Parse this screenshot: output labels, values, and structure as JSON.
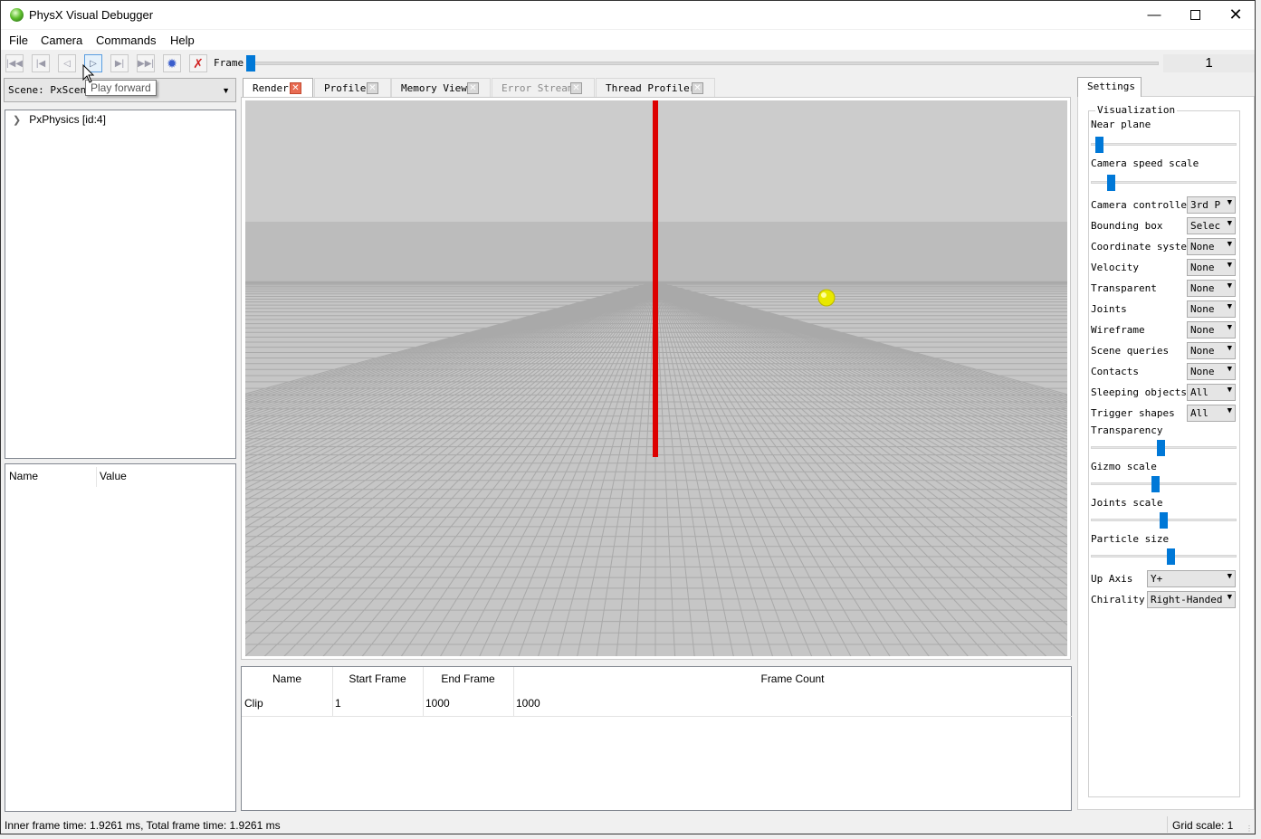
{
  "window": {
    "title": "PhysX Visual Debugger"
  },
  "menu": [
    "File",
    "Camera",
    "Commands",
    "Help"
  ],
  "toolbar": {
    "buttons": [
      "go-to-start",
      "step-back",
      "play-backward",
      "play-forward",
      "step-forward",
      "go-to-end",
      "record",
      "disconnect"
    ],
    "frame_label": "Frame",
    "frame_value": "1",
    "tooltip": "Play forward"
  },
  "scene": {
    "label": "Scene: PxScene"
  },
  "tree": {
    "items": [
      {
        "label": "PxPhysics [id:4]"
      }
    ]
  },
  "properties": {
    "headers": [
      "Name",
      "Value"
    ]
  },
  "tabs": [
    {
      "label": "Render",
      "active": true,
      "disabled": false
    },
    {
      "label": "Profile",
      "active": false,
      "disabled": false
    },
    {
      "label": "Memory View",
      "active": false,
      "disabled": false
    },
    {
      "label": "Error Stream",
      "active": false,
      "disabled": true
    },
    {
      "label": "Thread Profiler",
      "active": false,
      "disabled": false
    }
  ],
  "clips": {
    "headers": [
      "Name",
      "Start Frame",
      "End Frame",
      "Frame Count"
    ],
    "rows": [
      [
        "Clip",
        "1",
        "1000",
        "1000"
      ]
    ]
  },
  "settings": {
    "tab": "Settings",
    "group": "Visualization",
    "sliders": [
      {
        "label": "Near plane",
        "value": 0.03
      },
      {
        "label": "Camera speed scale",
        "value": 0.12
      },
      {
        "label": "Transparency",
        "value": 0.48
      },
      {
        "label": "Gizmo scale",
        "value": 0.44
      },
      {
        "label": "Joints scale",
        "value": 0.5
      },
      {
        "label": "Particle size",
        "value": 0.55
      }
    ],
    "selects": [
      {
        "label": "Camera controller",
        "value": "3rd P"
      },
      {
        "label": "Bounding box",
        "value": "Selec"
      },
      {
        "label": "Coordinate system",
        "value": "None"
      },
      {
        "label": "Velocity",
        "value": "None"
      },
      {
        "label": "Transparent",
        "value": "None"
      },
      {
        "label": "Joints",
        "value": "None"
      },
      {
        "label": "Wireframe",
        "value": "None"
      },
      {
        "label": "Scene queries",
        "value": "None"
      },
      {
        "label": "Contacts",
        "value": "None"
      },
      {
        "label": "Sleeping objects",
        "value": "All"
      },
      {
        "label": "Trigger shapes",
        "value": "All"
      }
    ],
    "up_axis": {
      "label": "Up Axis",
      "value": "Y+"
    },
    "chirality": {
      "label": "Chirality",
      "value": "Right-Handed"
    }
  },
  "status": {
    "left": "Inner frame time: 1.9261 ms, Total frame time: 1.9261 ms",
    "right": "Grid scale: 1"
  },
  "colors": {
    "accent": "#0078d7",
    "axis": "#dd0000",
    "ball": "#e8e800",
    "close_active": "#e86b52"
  }
}
